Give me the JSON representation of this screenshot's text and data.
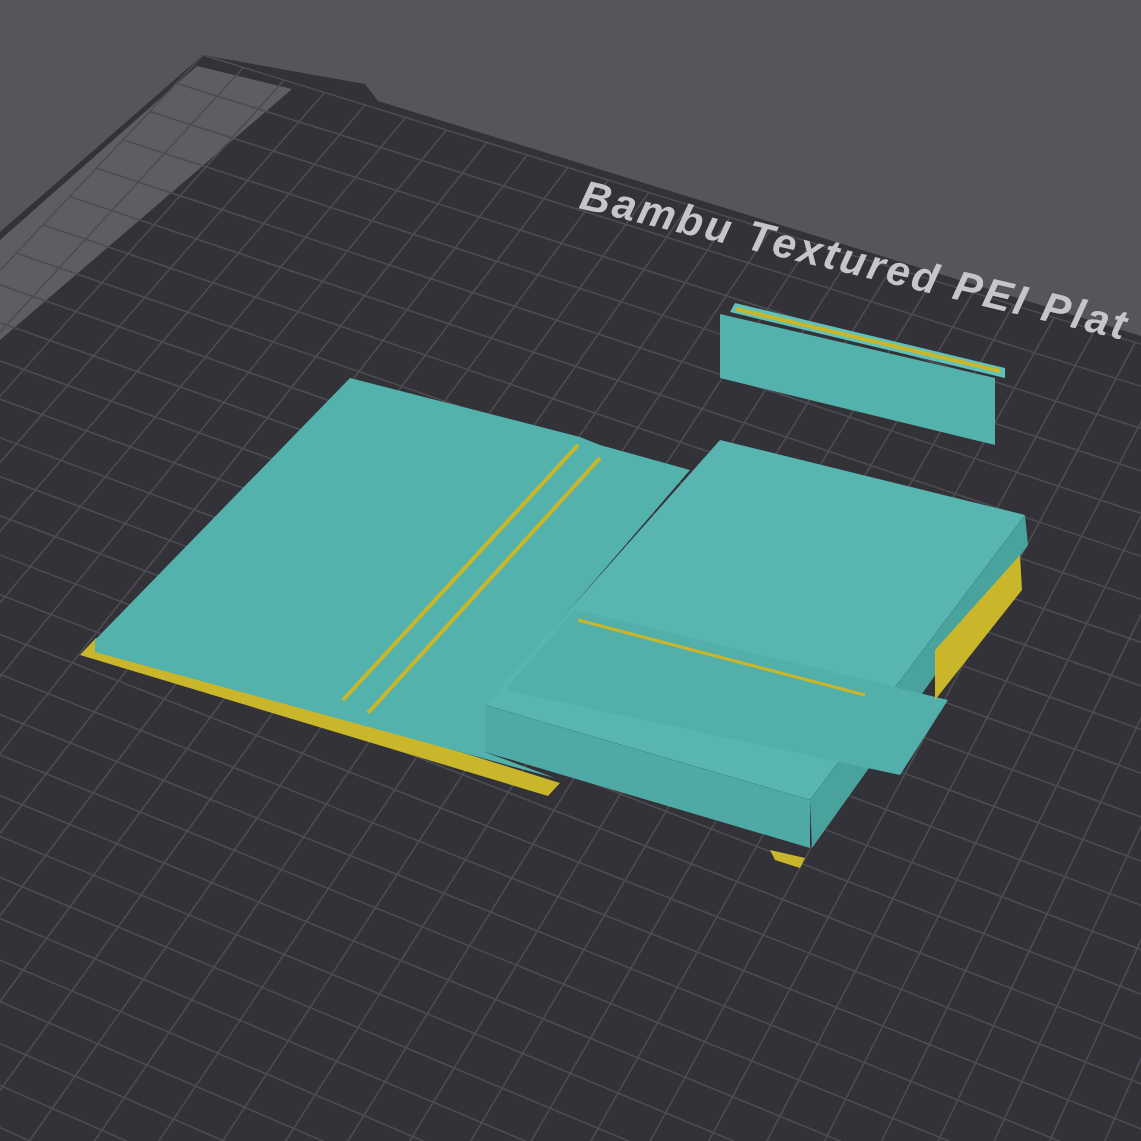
{
  "viewport": {
    "plate_label": "Bambu Textured PEI Plat"
  }
}
